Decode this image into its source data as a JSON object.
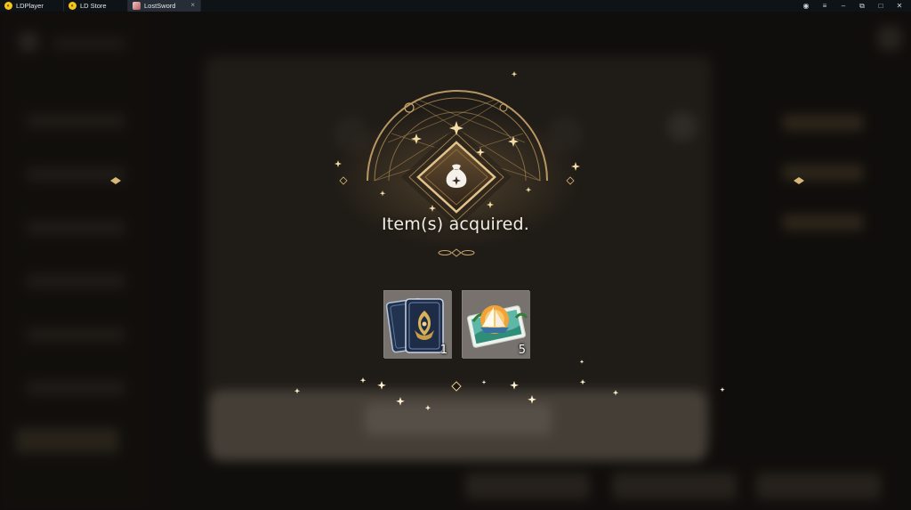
{
  "tabs": [
    {
      "label": "LDPlayer",
      "icon": "ldplayer-logo-icon"
    },
    {
      "label": "LD Store",
      "icon": "ldstore-logo-icon"
    },
    {
      "label": "LostSword",
      "icon": "lostsword-app-icon",
      "active": true
    }
  ],
  "window_controls": [
    "account-icon",
    "menu-icon",
    "minimize-icon",
    "screenshot-icon",
    "maximize-icon",
    "close-icon"
  ],
  "reward_popup": {
    "title": "Item(s) acquired.",
    "emblem_icon": "pouch-icon",
    "items": [
      {
        "name": "card-pack-item",
        "icon": "card-deck-icon",
        "quantity": "1"
      },
      {
        "name": "ticket-item",
        "icon": "island-boat-ticket-icon",
        "quantity": "5"
      }
    ]
  },
  "colors": {
    "gold": "#d8b877",
    "gold_dark": "#8a6a3a",
    "title_text": "#f2ede4",
    "backdrop": "#1a1714"
  }
}
